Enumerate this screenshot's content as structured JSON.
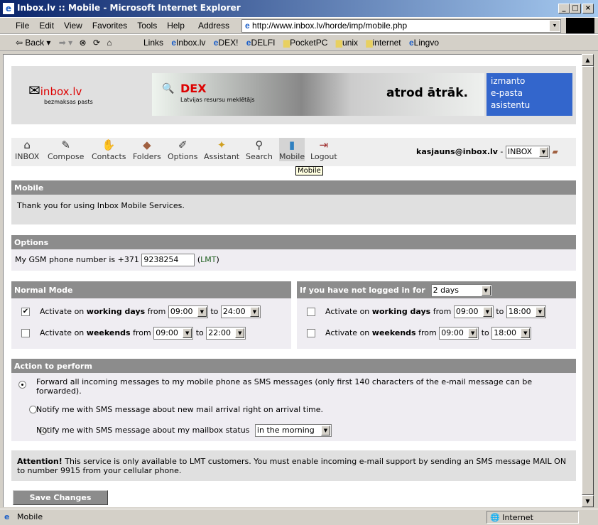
{
  "window": {
    "title": "Inbox.lv :: Mobile - Microsoft Internet Explorer"
  },
  "menu": [
    "File",
    "Edit",
    "View",
    "Favorites",
    "Tools",
    "Help"
  ],
  "address": {
    "label": "Address",
    "url": "http://www.inbox.lv/horde/imp/mobile.php"
  },
  "toolbar": {
    "back": "Back",
    "links_label": "Links"
  },
  "links": [
    "Inbox.lv",
    "DEX!",
    "DELFI",
    "PocketPC",
    "unix",
    "internet",
    "Lingvo"
  ],
  "banner": {
    "logo": "inbox.lv",
    "logo_sub": "bezmaksas pasts",
    "ad_brand": "DEX",
    "ad_sub": "Latvijas resursu meklētājs",
    "ad_slogan": "atrod ātrāk.",
    "side": [
      "izmanto",
      "e-pasta",
      "asistentu"
    ]
  },
  "nav": {
    "items": [
      "INBOX",
      "Compose",
      "Contacts",
      "Folders",
      "Options",
      "Assistant",
      "Search",
      "Mobile",
      "Logout"
    ],
    "user": "kasjauns@inbox.lv",
    "folder": "INBOX",
    "tooltip": "Mobile"
  },
  "mobile": {
    "title": "Mobile",
    "text": "Thank you for using Inbox Mobile Services."
  },
  "options": {
    "title": "Options",
    "label": "My GSM phone number is +371",
    "phone": "9238254",
    "operator": "LMT"
  },
  "normal": {
    "title": "Normal Mode",
    "wd_checked": true,
    "wd_from": "09:00",
    "wd_to": "24:00",
    "we_checked": false,
    "we_from": "09:00",
    "we_to": "22:00"
  },
  "away": {
    "title": "If you have not logged in for",
    "period": "2 days",
    "wd_from": "09:00",
    "wd_to": "18:00",
    "we_from": "09:00",
    "we_to": "18:00"
  },
  "labels": {
    "activate_on": "Activate on",
    "working_days": "working days",
    "weekends": "weekends",
    "from": "from",
    "to": "to"
  },
  "action": {
    "title": "Action to perform",
    "opt1": "Forward all incoming messages to my mobile phone as SMS messages (only first 140 characters of the e-mail message can be forwarded).",
    "opt2": "Notify me with SMS message about new mail arrival right on arrival time.",
    "opt3": "Notify me with SMS message about my mailbox status",
    "opt3_select": "in the morning",
    "selected": 1
  },
  "attention": {
    "bold": "Attention!",
    "text": " This service is only available to LMT customers. You must enable incoming e-mail support by sending an SMS message MAIL ON to number 9915 from your cellular phone."
  },
  "save": "Save Changes",
  "statusbar": {
    "left": "Mobile",
    "zone": "Internet"
  }
}
